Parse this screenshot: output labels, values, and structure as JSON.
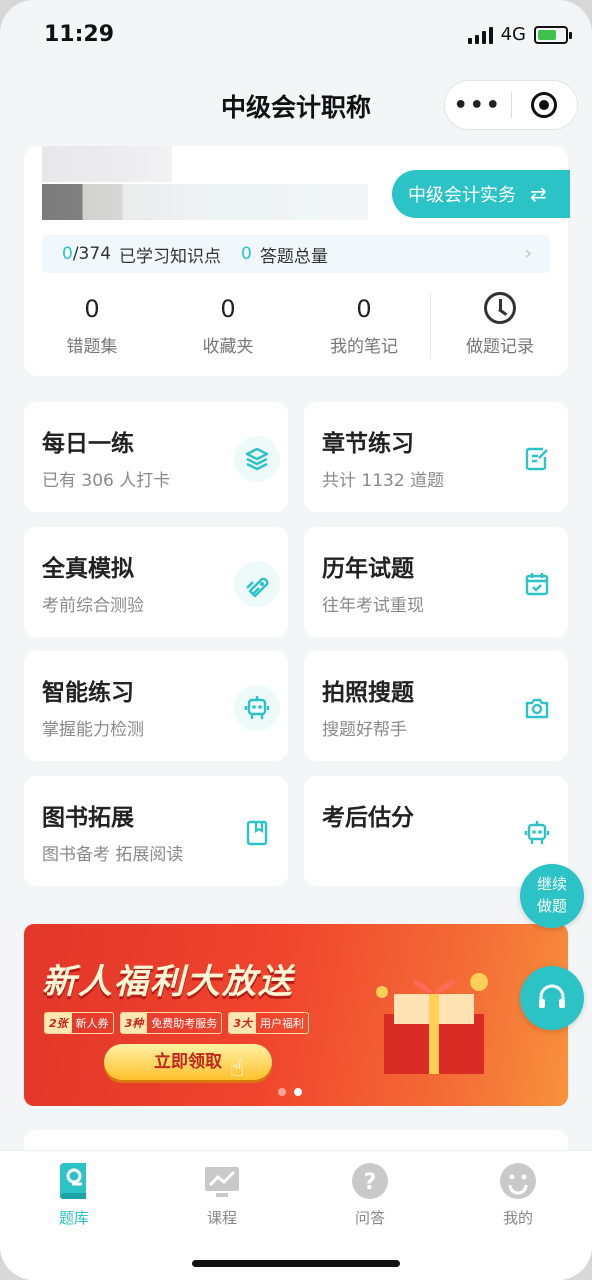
{
  "status_bar": {
    "time": "11:29",
    "network": "4G"
  },
  "header": {
    "title": "中级会计职称",
    "more_label": "•••"
  },
  "profile": {
    "subject_button": "中级会计实务",
    "stats": {
      "learned": "0",
      "total": "/374",
      "learned_label": "已学习知识点",
      "answered": "0",
      "answered_label": "答题总量"
    },
    "counters": [
      {
        "value": "0",
        "label": "错题集"
      },
      {
        "value": "0",
        "label": "收藏夹"
      },
      {
        "value": "0",
        "label": "我的笔记"
      },
      {
        "label": "做题记录",
        "icon": "history-icon"
      }
    ]
  },
  "tiles": [
    {
      "title": "每日一练",
      "subtitle": "已有 306 人打卡",
      "icon": "layers-icon"
    },
    {
      "title": "章节练习",
      "subtitle": "共计 1132 道题",
      "icon": "edit-note-icon"
    },
    {
      "title": "全真模拟",
      "subtitle": "考前综合测验",
      "icon": "rocket-icon"
    },
    {
      "title": "历年试题",
      "subtitle": "往年考试重现",
      "icon": "calendar-check-icon"
    },
    {
      "title": "智能练习",
      "subtitle": "掌握能力检测",
      "icon": "robot-icon"
    },
    {
      "title": "拍照搜题",
      "subtitle": "搜题好帮手",
      "icon": "camera-icon"
    },
    {
      "title": "图书拓展",
      "subtitle": "图书备考 拓展阅读",
      "icon": "book-icon"
    },
    {
      "title": "考后估分",
      "subtitle": "",
      "icon": "robot-icon"
    }
  ],
  "floating": {
    "continue_label_1": "继续",
    "continue_label_2": "做题"
  },
  "banner": {
    "headline": "新人福利大放送",
    "tags": [
      {
        "k": "2张",
        "v": "新人券"
      },
      {
        "k": "3种",
        "v": "免费助考服务"
      },
      {
        "k": "3大",
        "v": "用户福利"
      }
    ],
    "cta": "立即领取"
  },
  "tabbar": [
    {
      "label": "题库",
      "icon": "question-bank-icon",
      "active": true
    },
    {
      "label": "课程",
      "icon": "course-icon",
      "active": false
    },
    {
      "label": "问答",
      "icon": "qa-icon",
      "active": false
    },
    {
      "label": "我的",
      "icon": "profile-icon",
      "active": false
    }
  ],
  "colors": {
    "accent": "#2cc3c7",
    "banner_red": "#f0442d",
    "background": "#f4f5f7"
  }
}
